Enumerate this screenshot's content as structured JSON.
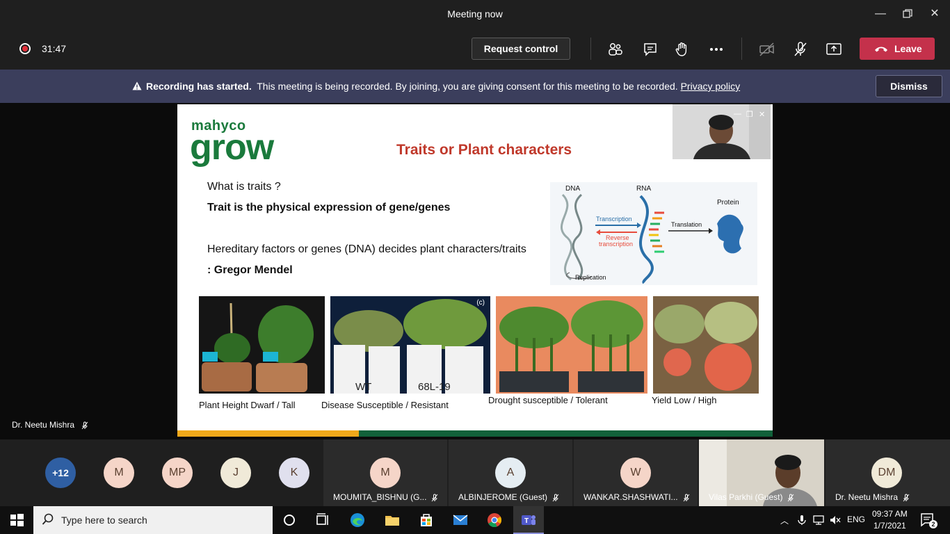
{
  "window": {
    "title": "Meeting now"
  },
  "toolbar": {
    "timer": "31:47",
    "request_control": "Request control",
    "leave": "Leave",
    "icons": [
      "participants-icon",
      "chat-icon",
      "raise-hand-icon",
      "more-icon",
      "camera-off-icon",
      "mic-off-icon",
      "share-icon"
    ]
  },
  "banner": {
    "bold": "Recording has started.",
    "text": "This meeting is being recorded. By joining, you are giving consent for this meeting to be recorded.",
    "link": "Privacy policy",
    "dismiss": "Dismiss"
  },
  "slide": {
    "logo_top": "mahyco",
    "logo_main": "grow",
    "title": "Traits or Plant characters",
    "question": "What is traits ?",
    "definition": "Trait is the physical expression of gene/genes",
    "hereditary": "Hereditary factors or genes (DNA) decides plant characters/traits",
    "attribution": ": Gregor Mendel",
    "diagram": {
      "dna": "DNA",
      "rna": "RNA",
      "protein": "Protein",
      "transcription": "Transcription",
      "reverse": "Reverse",
      "reverse2": "transcription",
      "translation": "Translation",
      "replication": "Replication"
    },
    "photo2_labels": {
      "left": "WT",
      "right": "68L-19",
      "corner": "(c)"
    },
    "captions": [
      "Plant Height Dwarf  / Tall",
      "Disease  Susceptible   /  Resistant",
      "Drought susceptible /     Tolerant",
      "Yield    Low  /     High"
    ]
  },
  "speaker": {
    "name": "Dr. Neetu Mishra"
  },
  "participants": {
    "overflow": "+12",
    "avatars": [
      {
        "initials": "M",
        "color": "#f5d5c8"
      },
      {
        "initials": "MP",
        "color": "#f5d5c8"
      },
      {
        "initials": "J",
        "color": "#f0ead8"
      },
      {
        "initials": "K",
        "color": "#e0e0ee"
      }
    ],
    "tiles": [
      {
        "initials": "M",
        "name": "MOUMITA_BISHNU (G...",
        "color": "#f5d5c8"
      },
      {
        "initials": "A",
        "name": "ALBINJEROME (Guest)",
        "color": "#e5edf2"
      },
      {
        "initials": "W",
        "name": "WANKAR.SHASHWATI...",
        "color": "#f5d5c8"
      },
      {
        "initials": "",
        "name": "Vilas Parkhi (Guest)",
        "color": ""
      },
      {
        "initials": "DM",
        "name": "Dr. Neetu Mishra",
        "color": "#f0ead8"
      }
    ]
  },
  "taskbar": {
    "search_placeholder": "Type here to search",
    "language": "ENG",
    "time": "09:37 AM",
    "date": "1/7/2021",
    "notifications": "2"
  }
}
